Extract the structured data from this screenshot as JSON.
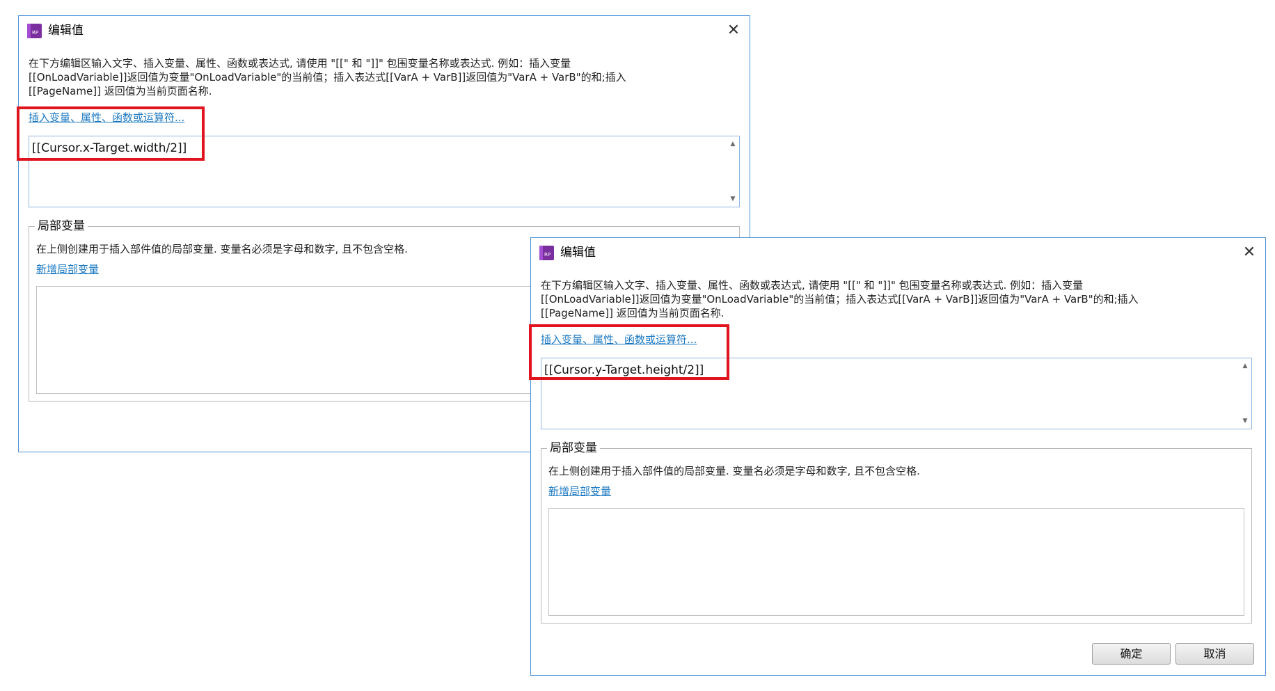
{
  "dialog1": {
    "title": "编辑值",
    "icon_label": "RP",
    "close_symbol": "✕",
    "description": "在下方编辑区输入文字、插入变量、属性、函数或表达式, 请使用 \"[[\" 和 \"]]\" 包围变量名称或表达式. 例如：插入变量\n[[OnLoadVariable]]返回值为变量\"OnLoadVariable\"的当前值；插入表达式[[VarA + VarB]]返回值为\"VarA + VarB\"的和;插入\n[[PageName]] 返回值为当前页面名称.",
    "insert_link": "插入变量、属性、函数或运算符...",
    "editor_value": "[[Cursor.x-Target.width/2]]",
    "scroll_up": "▲",
    "scroll_down": "▼",
    "local_vars": {
      "title": "局部变量",
      "description": "在上侧创建用于插入部件值的局部变量. 变量名必须是字母和数字, 且不包含空格.",
      "add_link": "新增局部变量"
    }
  },
  "dialog2": {
    "title": "编辑值",
    "icon_label": "RP",
    "close_symbol": "✕",
    "description": "在下方编辑区输入文字、插入变量、属性、函数或表达式, 请使用 \"[[\" 和 \"]]\" 包围变量名称或表达式. 例如：插入变量\n[[OnLoadVariable]]返回值为变量\"OnLoadVariable\"的当前值；插入表达式[[VarA + VarB]]返回值为\"VarA + VarB\"的和;插入\n[[PageName]] 返回值为当前页面名称.",
    "insert_link": "插入变量、属性、函数或运算符...",
    "editor_value": "[[Cursor.y-Target.height/2]]",
    "scroll_up": "▲",
    "scroll_down": "▼",
    "local_vars": {
      "title": "局部变量",
      "description": "在上侧创建用于插入部件值的局部变量. 变量名必须是字母和数字, 且不包含空格.",
      "add_link": "新增局部变量"
    },
    "ok_label": "确定",
    "cancel_label": "取消"
  },
  "colors": {
    "highlight": "#e0141e",
    "link": "#1a78c2",
    "dialog_border": "#4a90d9"
  }
}
